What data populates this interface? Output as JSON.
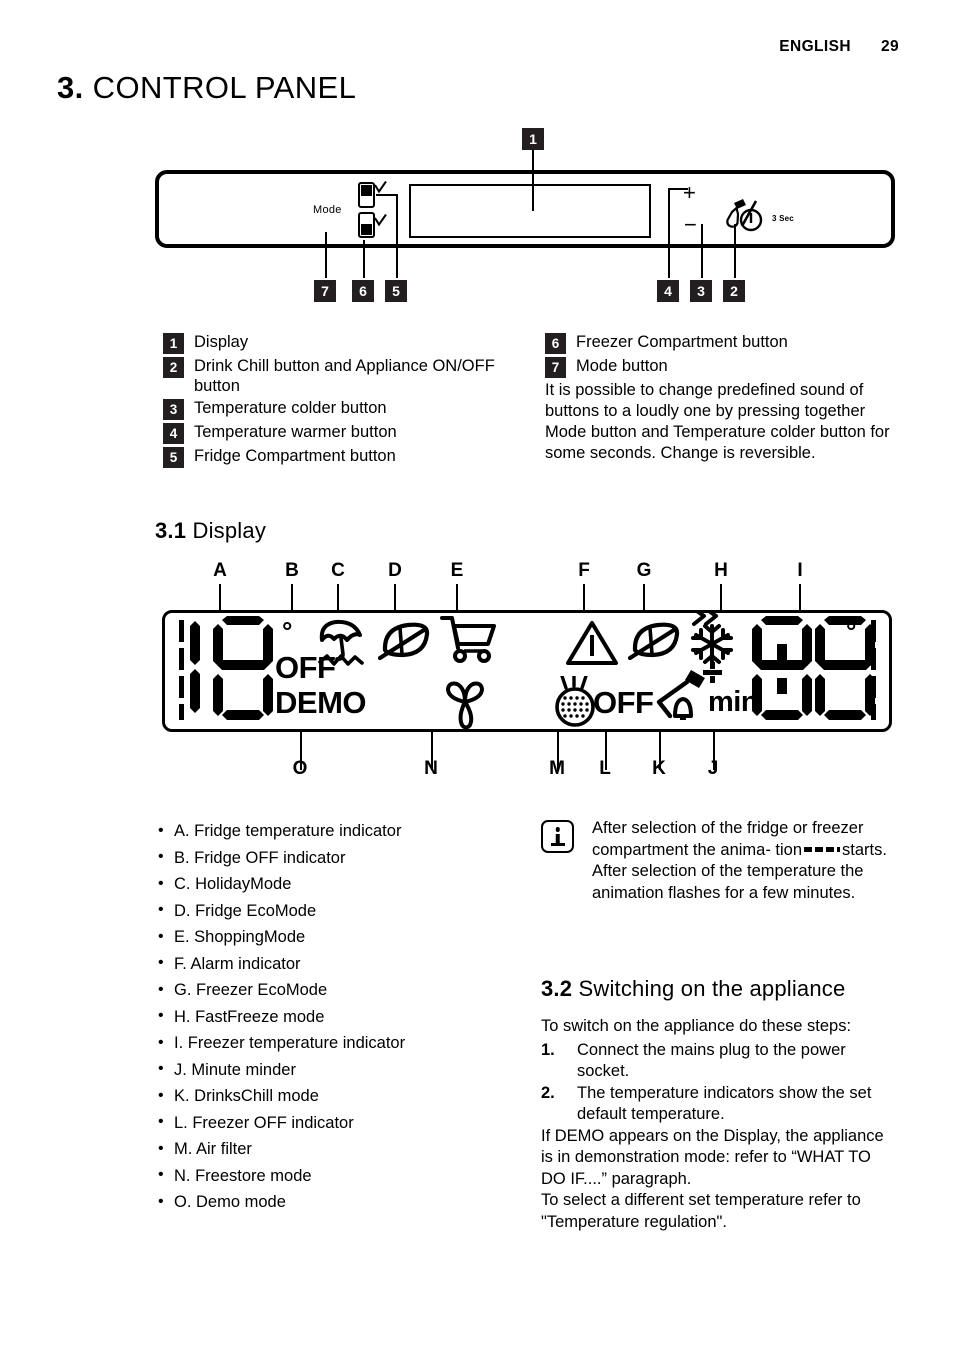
{
  "header": {
    "language": "ENGLISH",
    "page_number": "29"
  },
  "chapter": {
    "number": "3.",
    "title": "CONTROL PANEL"
  },
  "control_panel_figure": {
    "mode_label": "Mode",
    "plus_label": "+",
    "minus_label": "−",
    "sec_label": "3 Sec",
    "callouts": [
      "1",
      "2",
      "3",
      "4",
      "5",
      "6",
      "7"
    ],
    "icons": {
      "fridge_compartment": "compartment-check-icon",
      "freezer_compartment": "compartment-check-icon",
      "power": "drink-chill-power-icon"
    }
  },
  "legend_left": [
    {
      "num": "1",
      "text": "Display"
    },
    {
      "num": "2",
      "text": "Drink Chill button and Appliance ON/OFF button"
    },
    {
      "num": "3",
      "text": "Temperature colder button"
    },
    {
      "num": "4",
      "text": "Temperature warmer button"
    },
    {
      "num": "5",
      "text": "Fridge Compartment button"
    }
  ],
  "legend_right": [
    {
      "num": "6",
      "text": "Freezer Compartment button"
    },
    {
      "num": "7",
      "text": "Mode button"
    }
  ],
  "legend_right_note": "It is possible to change predefined sound of buttons to a loudly one by pressing together Mode button and Temperature colder button for some seconds. Change is reversible.",
  "section_display": {
    "number": "3.1",
    "title": "Display"
  },
  "lcd_figure": {
    "top_letters": [
      "A",
      "B",
      "C",
      "D",
      "E",
      "F",
      "G",
      "H",
      "I"
    ],
    "bottom_letters": [
      "O",
      "N",
      "M",
      "L",
      "K",
      "J"
    ],
    "texts": {
      "off_left": "OFF",
      "demo": "DEMO",
      "off_right": "OFF",
      "min": "min",
      "degree_left": "°",
      "degree_right": "°"
    },
    "icons": {
      "C": "holiday-umbrella-icon",
      "D": "fridge-eco-leaf-icon",
      "E": "shopping-cart-icon",
      "F": "alarm-triangle-icon",
      "G": "freezer-eco-leaf-icon",
      "H": "fastfreeze-snowflake-icon",
      "K": "drinks-chill-icon",
      "M": "air-filter-icon",
      "N": "freestore-propeller-icon"
    }
  },
  "display_items": [
    "A. Fridge temperature indicator",
    "B. Fridge OFF indicator",
    "C. HolidayMode",
    "D. Fridge EcoMode",
    "E. ShoppingMode",
    "F. Alarm indicator",
    "G. Freezer EcoMode",
    "H. FastFreeze mode",
    "I. Freezer temperature indicator",
    "J. Minute minder",
    "K. DrinksChill mode",
    "L. Freezer OFF indicator",
    "M. Air filter",
    "N. Freestore mode",
    "O. Demo mode"
  ],
  "info_box": {
    "icon": "info-icon",
    "line1": "After selection of the fridge or freezer compartment the anima-",
    "line2_prefix": "tion",
    "line2_suffix": "starts.",
    "line3": "After selection of the temperature the animation flashes for a few minutes."
  },
  "section_switching": {
    "number": "3.2",
    "title": "Switching on the appliance",
    "intro": "To switch on the appliance do these steps:",
    "steps": [
      {
        "num": "1.",
        "text": "Connect the mains plug to the power socket."
      },
      {
        "num": "2.",
        "text": "The temperature indicators show the set default temperature."
      }
    ],
    "note1": "If DEMO appears on the Display, the appliance is in demonstration mode: refer to “WHAT TO DO IF....” paragraph.",
    "note2": "To select a different set temperature refer to \"Temperature regulation\"."
  },
  "colors": {
    "ink": "#000000",
    "callout_bg": "#231f20",
    "callout_fg": "#ffffff",
    "page_bg": "#ffffff"
  }
}
